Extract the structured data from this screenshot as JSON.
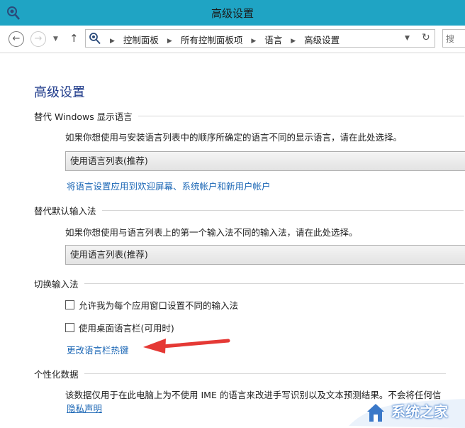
{
  "window": {
    "title": "高级设置"
  },
  "navbar": {
    "breadcrumbs": [
      "控制面板",
      "所有控制面板项",
      "语言",
      "高级设置"
    ],
    "search_placeholder": "搜"
  },
  "page": {
    "title": "高级设置",
    "sections": [
      {
        "header": "替代 Windows 显示语言",
        "description": "如果你想使用与安装语言列表中的顺序所确定的语言不同的显示语言，请在此处选择。",
        "dropdown_value": "使用语言列表(推荐)",
        "link": "将语言设置应用到欢迎屏幕、系统帐户和新用户帐户"
      },
      {
        "header": "替代默认输入法",
        "description": "如果你想使用与语言列表上的第一个输入法不同的输入法，请在此处选择。",
        "dropdown_value": "使用语言列表(推荐)"
      },
      {
        "header": "切换输入法",
        "checkboxes": [
          {
            "label": "允许我为每个应用窗口设置不同的输入法",
            "checked": false
          },
          {
            "label": "使用桌面语言栏(可用时)",
            "checked": false
          }
        ],
        "link": "更改语言栏热键"
      },
      {
        "header": "个性化数据",
        "description": "该数据仅用于在此电脑上为不使用 IME 的语言来改进手写识别以及文本预测结果。不会将任何信",
        "link": "隐私声明"
      }
    ]
  },
  "watermark": {
    "text": "系统之家"
  },
  "colors": {
    "titlebar": "#1fa4c4",
    "link": "#1a66b5",
    "heading": "#1e3a8a",
    "arrow": "#e53935"
  },
  "icons": [
    "control-panel-icon",
    "back-arrow-icon",
    "forward-arrow-icon",
    "chevron-down-icon",
    "up-arrow-icon",
    "refresh-icon",
    "red-arrow-annotation"
  ]
}
